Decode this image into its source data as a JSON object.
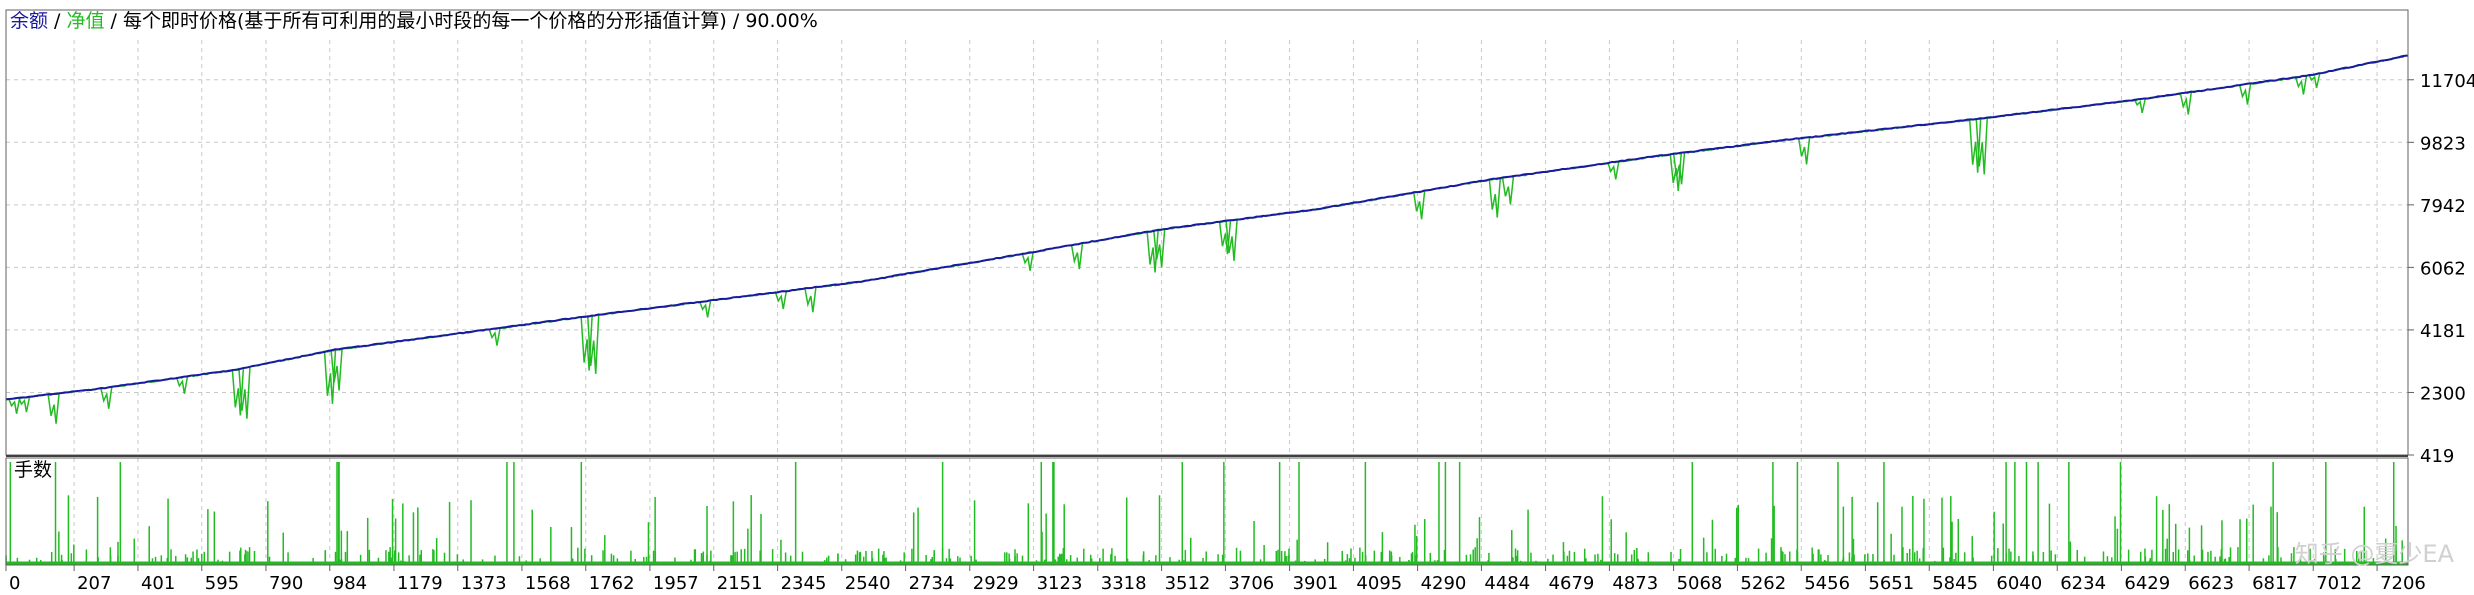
{
  "title": {
    "balance_label": "余额",
    "sep1": " / ",
    "equity_label": "净值",
    "sep2": " / ",
    "model_label": "每个即时价格(基于所有可利用的最小时段的每一个价格的分形插值计算)",
    "sep3": " / ",
    "quality": "90.00%"
  },
  "colors": {
    "balance": "#1a1aa0",
    "equity": "#22bb22",
    "lots": "#22bb22",
    "grid": "#c8c8c8",
    "axis": "#606060",
    "text": "#000000"
  },
  "lots_panel_label": "手数",
  "watermark": "知乎 @夏少EA",
  "chart_data": [
    {
      "type": "line",
      "title": "",
      "xlabel": "",
      "ylabel": "",
      "xlim": [
        0,
        7300
      ],
      "ylim": [
        419,
        12900
      ],
      "y_ticks": [
        419,
        2300,
        4181,
        6062,
        7942,
        9823,
        11704
      ],
      "x_ticks": [
        0,
        207,
        401,
        595,
        790,
        984,
        1179,
        1373,
        1568,
        1762,
        1957,
        2151,
        2345,
        2540,
        2734,
        2929,
        3123,
        3318,
        3512,
        3706,
        3901,
        4095,
        4290,
        4484,
        4679,
        4873,
        5068,
        5262,
        5456,
        5651,
        5845,
        6040,
        6234,
        6429,
        6623,
        6817,
        7012,
        7206
      ],
      "grid": true,
      "series": [
        {
          "name": "余额",
          "points": [
            [
              0,
              2100
            ],
            [
              300,
              2450
            ],
            [
              700,
              3000
            ],
            [
              1000,
              3600
            ],
            [
              1500,
              4250
            ],
            [
              1800,
              4650
            ],
            [
              2200,
              5150
            ],
            [
              2600,
              5650
            ],
            [
              3100,
              6500
            ],
            [
              3500,
              7200
            ],
            [
              4000,
              7850
            ],
            [
              4500,
              8700
            ],
            [
              5000,
              9400
            ],
            [
              5400,
              9900
            ],
            [
              6000,
              10550
            ],
            [
              6500,
              11150
            ],
            [
              7000,
              11850
            ],
            [
              7300,
              12450
            ]
          ]
        },
        {
          "name": "净值",
          "drawdowns": [
            [
              20,
              1900
            ],
            [
              50,
              1950
            ],
            [
              140,
              1600
            ],
            [
              300,
              2050
            ],
            [
              530,
              2500
            ],
            [
              700,
              1850
            ],
            [
              720,
              1750
            ],
            [
              980,
              2200
            ],
            [
              1000,
              2600
            ],
            [
              1480,
              3950
            ],
            [
              1760,
              3200
            ],
            [
              1780,
              3100
            ],
            [
              2120,
              4800
            ],
            [
              2350,
              5050
            ],
            [
              2440,
              4950
            ],
            [
              3100,
              6200
            ],
            [
              3250,
              6250
            ],
            [
              3480,
              6150
            ],
            [
              3500,
              6300
            ],
            [
              3700,
              6700
            ],
            [
              3720,
              6500
            ],
            [
              4290,
              7750
            ],
            [
              4520,
              7800
            ],
            [
              4560,
              8200
            ],
            [
              4880,
              8950
            ],
            [
              5070,
              8600
            ],
            [
              5080,
              8800
            ],
            [
              5460,
              9400
            ],
            [
              5980,
              9150
            ],
            [
              6000,
              9100
            ],
            [
              6480,
              10950
            ],
            [
              6620,
              10900
            ],
            [
              6800,
              11200
            ],
            [
              6970,
              11500
            ],
            [
              7010,
              11700
            ]
          ]
        }
      ]
    },
    {
      "type": "bar",
      "title": "手数",
      "x_count": 7300,
      "y_ticks": [],
      "note_series": "lots per trade, mostly small with occasional spikes to full panel height"
    }
  ]
}
